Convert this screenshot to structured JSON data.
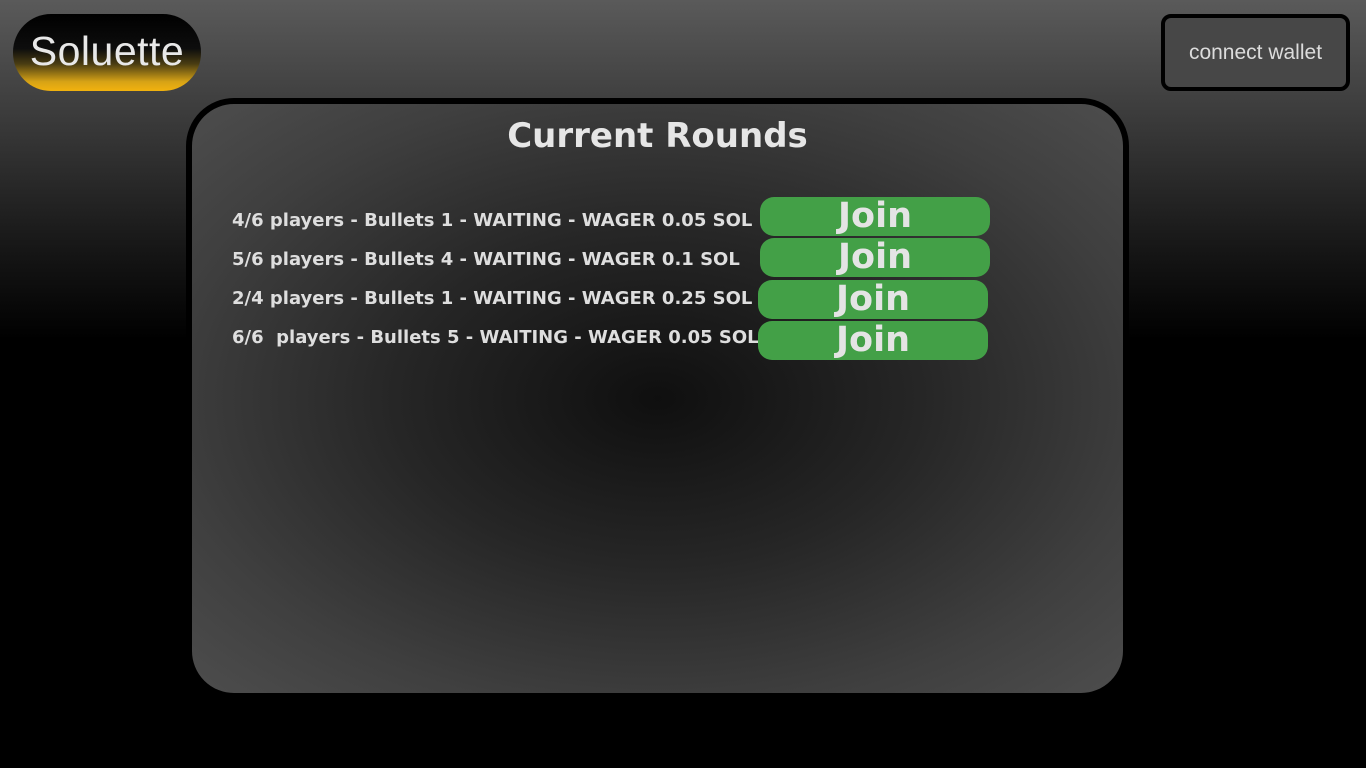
{
  "header": {
    "logo_text": "Soluette",
    "wallet_button_label": "connect wallet"
  },
  "main": {
    "title": "Current Rounds",
    "rounds": [
      {
        "text": "4/6 players - Bullets 1 - WAITING - WAGER 0.05 SOL",
        "join_label": "Join"
      },
      {
        "text": "5/6 players - Bullets 4 - WAITING - WAGER 0.1 SOL",
        "join_label": "Join"
      },
      {
        "text": "2/4 players - Bullets 1 - WAITING - WAGER 0.25 SOL",
        "join_label": "Join"
      },
      {
        "text": "6/6  players - Bullets 5 - WAITING - WAGER 0.05 SOL",
        "join_label": "Join"
      }
    ]
  },
  "colors": {
    "join_button": "#43a047",
    "logo_accent": "#f2b20e",
    "panel_border": "#000000"
  }
}
